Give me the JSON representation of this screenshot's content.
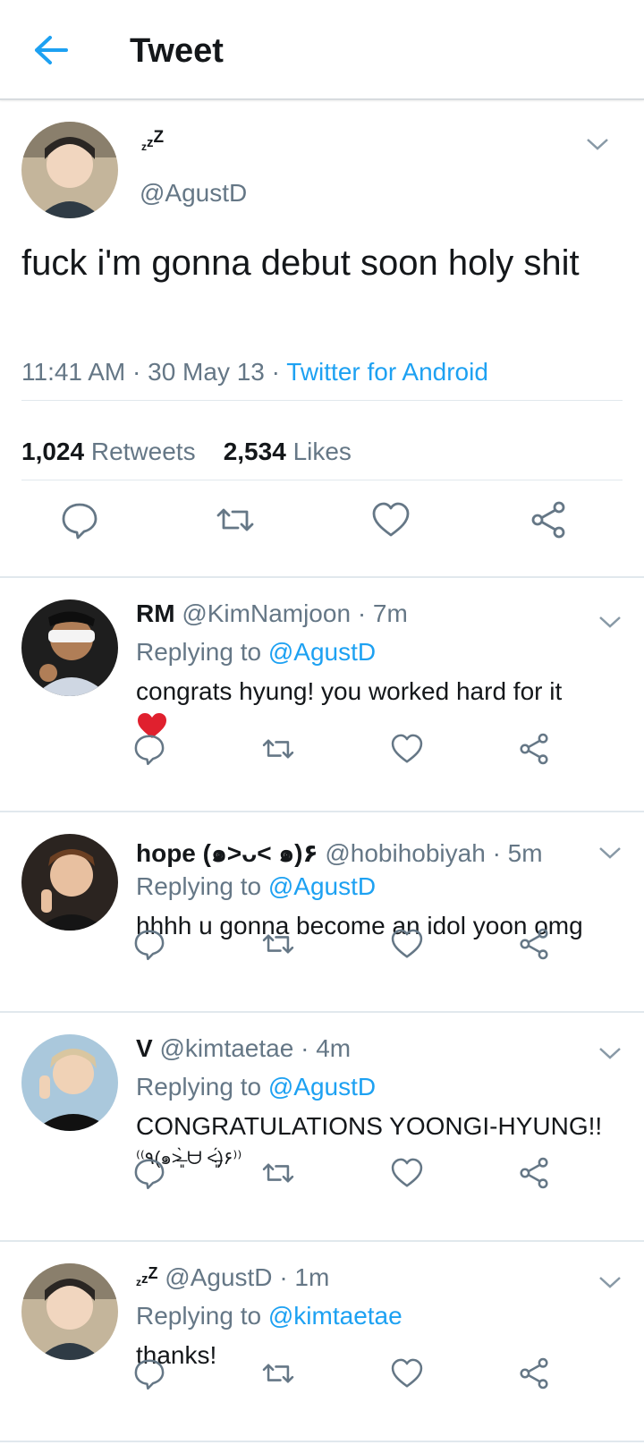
{
  "header": {
    "title": "Tweet"
  },
  "main_tweet": {
    "display_name": "zzz",
    "handle": "@AgustD",
    "text": "fuck i'm gonna debut soon holy shit",
    "time": "11:41 AM",
    "date": "30 May 13",
    "source": "Twitter for Android",
    "retweets_count": "1,024",
    "retweets_label": "Retweets",
    "likes_count": "2,534",
    "likes_label": "Likes"
  },
  "replies": [
    {
      "name": "RM",
      "handle": "@KimNamjoon",
      "time": "7m",
      "replying_label": "Replying to",
      "replying_to": "@AgustD",
      "text": "congrats hyung! you worked hard for it"
    },
    {
      "name": "hope (๑>ᴗ< ๑)۶",
      "handle": "@hobihobiyah",
      "time": "5m",
      "replying_label": "Replying to",
      "replying_to": "@AgustD",
      "text": "hhhh u gonna become an idol yoon omg"
    },
    {
      "name": "V",
      "handle": "@kimtaetae",
      "time": "4m",
      "replying_label": "Replying to",
      "replying_to": "@AgustD",
      "text": "CONGRATULATIONS YOONGI-HYUNG!!",
      "kaomoji": "⁽⁽٩(๑˃̶͈̀ ᗨ ˂̶͈́)۶⁾⁾"
    },
    {
      "name": "zzz",
      "handle": "@AgustD",
      "time": "1m",
      "replying_label": "Replying to",
      "replying_to": "@kimtaetae",
      "text": "thanks!"
    }
  ],
  "colors": {
    "accent": "#1da1f2",
    "muted": "#657786",
    "text": "#14171a",
    "divider": "#e1e8ed"
  },
  "icons": [
    "back-arrow-icon",
    "chevron-down-icon",
    "reply-icon",
    "retweet-icon",
    "like-icon",
    "share-icon",
    "red-heart-emoji"
  ]
}
